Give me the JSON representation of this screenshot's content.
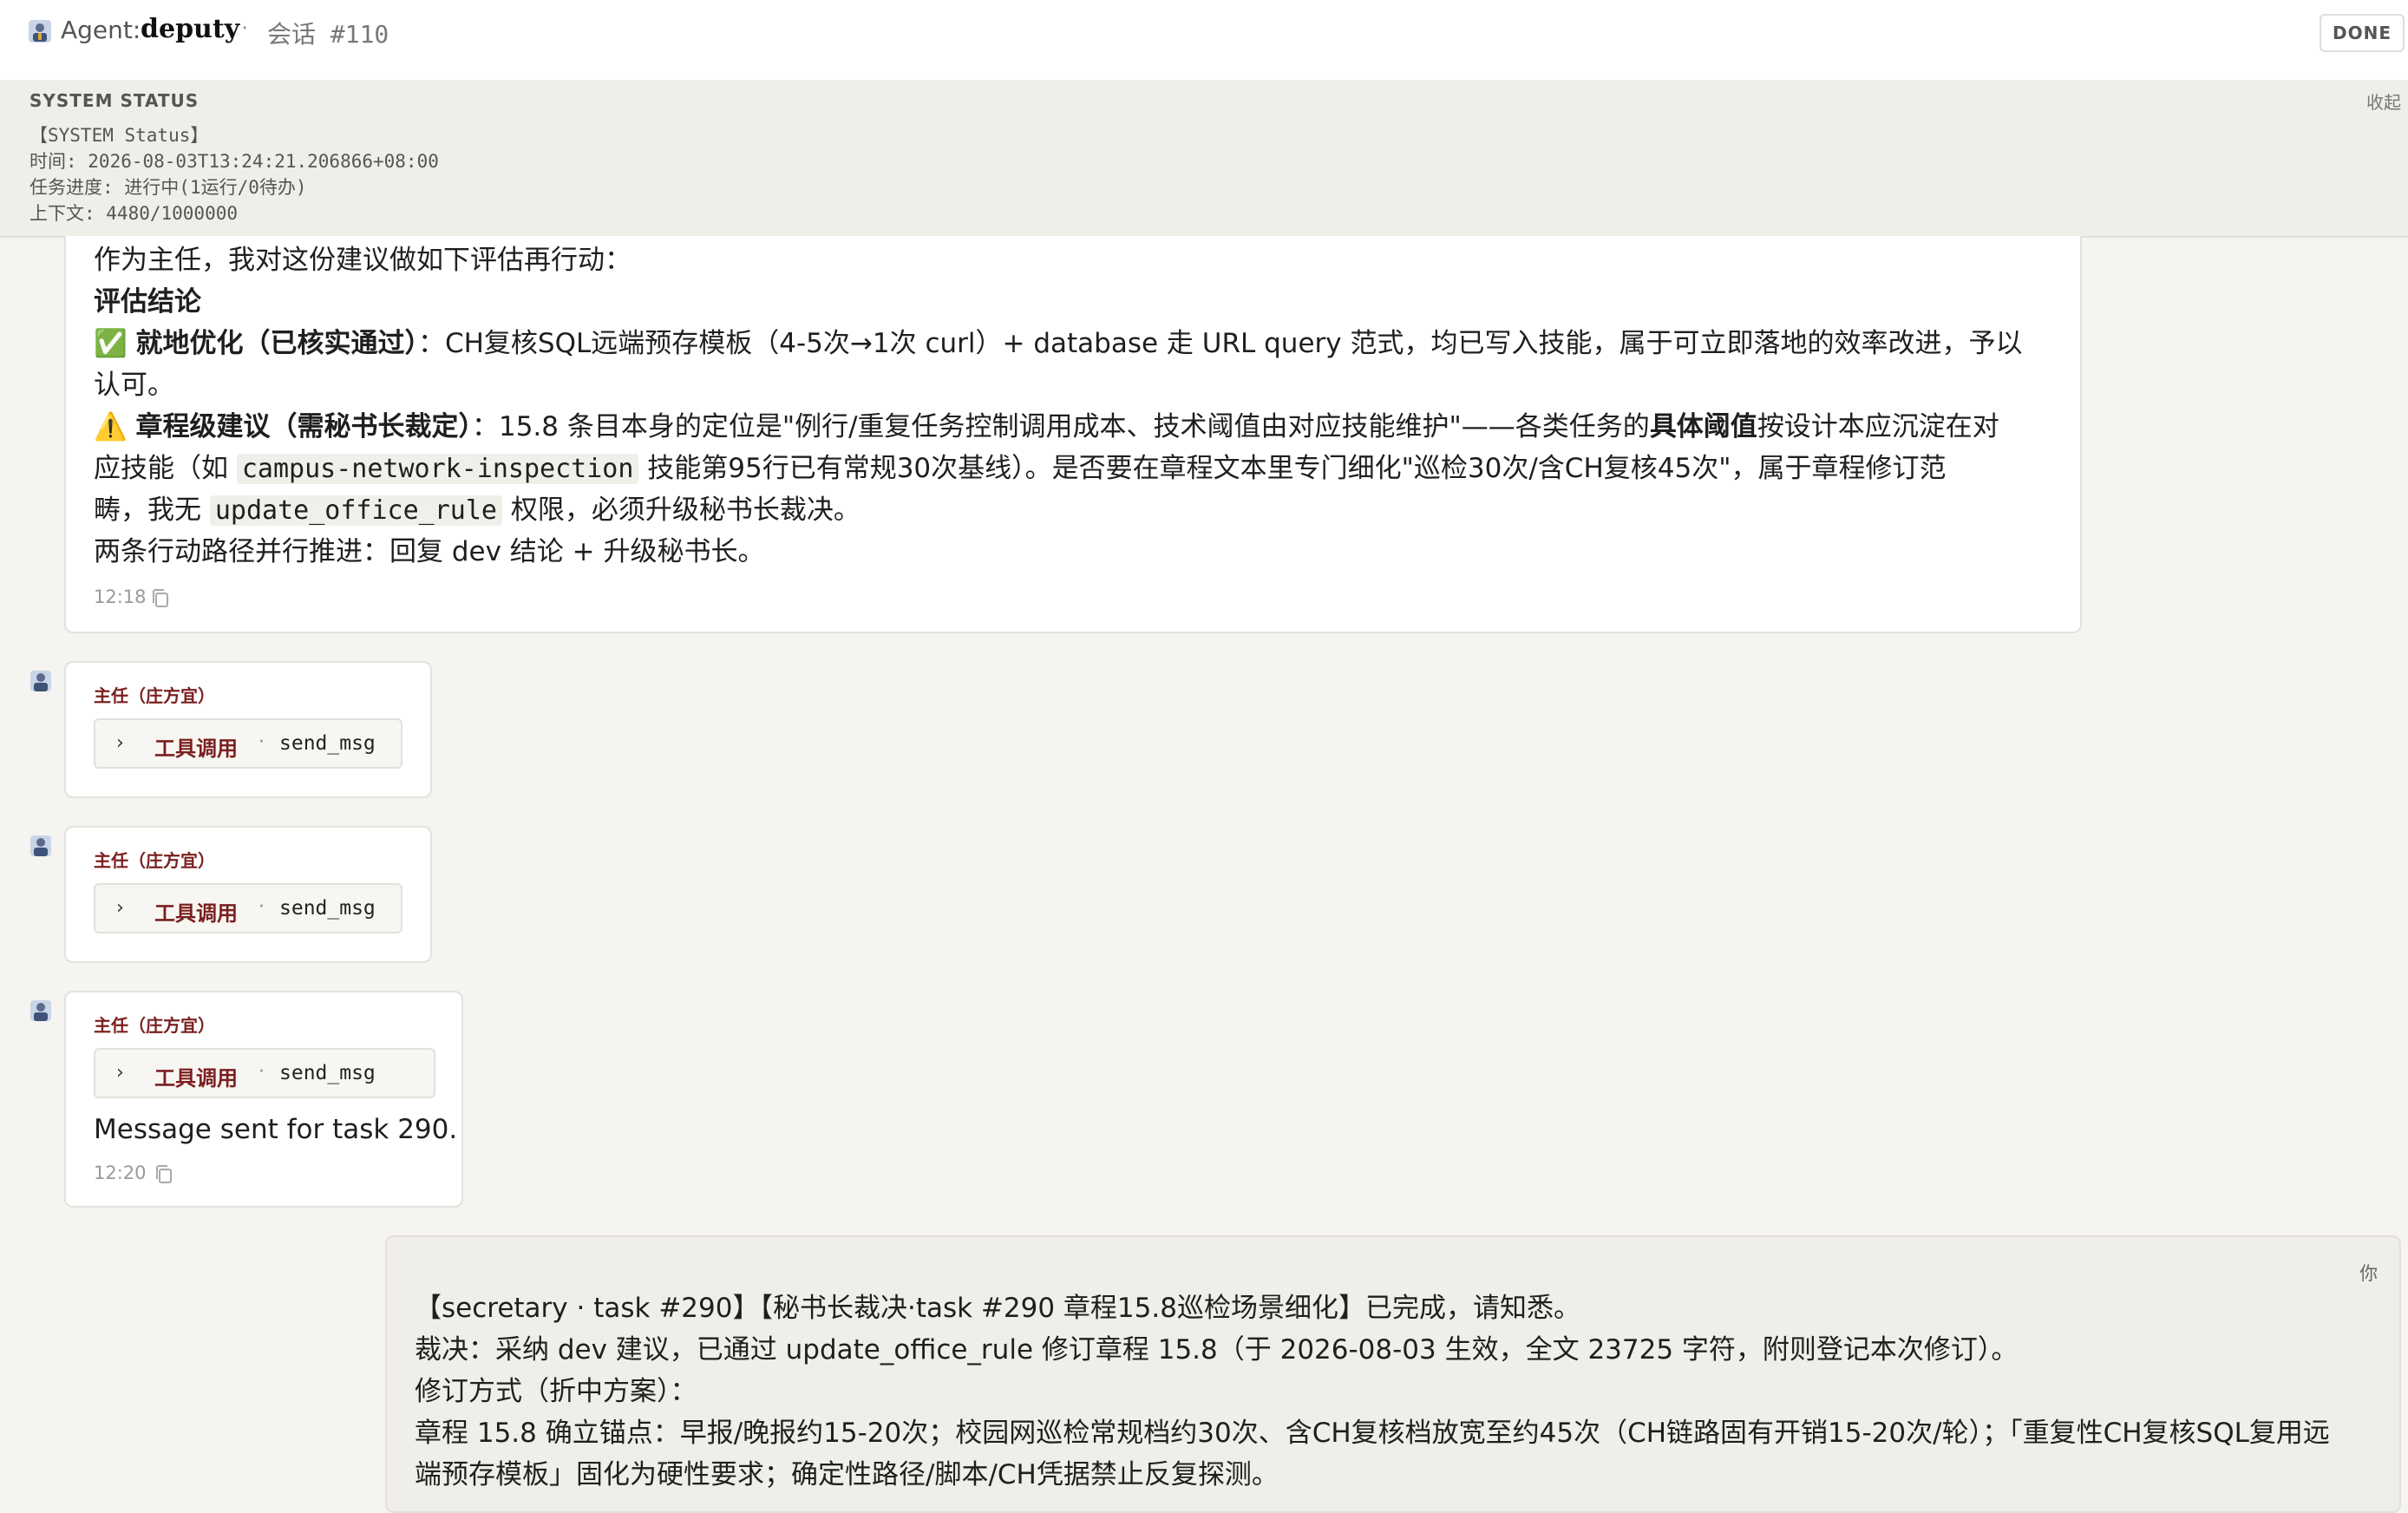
{
  "header": {
    "agent_label": "Agent:",
    "agent_name": "deputy",
    "separator": "·",
    "session": "会话 #110",
    "done_button": "DONE"
  },
  "system_status": {
    "title": "SYSTEM STATUS",
    "collapse": "收起",
    "lines": [
      "【SYSTEM Status】",
      "时间: 2026-08-03T13:24:21.206866+08:00",
      "任务进度: 进行中(1运行/0待办)",
      "上下文: 4480/1000000"
    ]
  },
  "messages": {
    "first": {
      "intro": "作为主任，我对这份建议做如下评估再行动：",
      "heading": "评估结论",
      "item1_icon": "✅",
      "item1_bold": "就地优化（已核实通过）",
      "item1_text_a": "：CH复核SQL远端预存模板（4-5次→1次 curl）+ database 走 URL query 范式，均已写入技能，属于可立即落地的效率改进，予以",
      "item1_text_b": "认可。",
      "item2_icon": "⚠️",
      "item2_bold": "章程级建议（需秘书长裁定）",
      "item2_text_a1": "：15.8 条目本身的定位是\"例行/重复任务控制调用成本、技术阈值由对应技能维护\"——各类任务的",
      "item2_bold2": "具体阈值",
      "item2_text_a2": "按设计本应沉淀在对",
      "item2_text_b1": "应技能（如 ",
      "item2_code1": "campus-network-inspection",
      "item2_text_b2": " 技能第95行已有常规30次基线）。是否要在章程文本里专门细化\"巡检30次/含CH复核45次\"，属于章程修订范",
      "item2_text_c1": "畴，我无 ",
      "item2_code2": "update_office_rule",
      "item2_text_c2": " 权限，必须升级秘书长裁决。",
      "closing": "两条行动路径并行推进：回复 dev 结论 + 升级秘书长。",
      "time": "12:18"
    },
    "tool1": {
      "sender": "主任（庄方宜）",
      "tool_label": "工具调用",
      "sep": "·",
      "tool_name": "send_msg"
    },
    "tool2": {
      "sender": "主任（庄方宜）",
      "tool_label": "工具调用",
      "sep": "·",
      "tool_name": "send_msg"
    },
    "tool3": {
      "sender": "主任（庄方宜）",
      "tool_label": "工具调用",
      "sep": "·",
      "tool_name": "send_msg",
      "result": "Message sent for task 290.",
      "time": "12:20"
    },
    "user": {
      "label": "你",
      "line1": "【secretary · task #290】【秘书长裁决·task #290 章程15.8巡检场景细化】已完成，请知悉。",
      "line2": "裁决：采纳 dev 建议，已通过 update_office_rule 修订章程 15.8（于 2026-08-03 生效，全文 23725 字符，附则登记本次修订）。",
      "line3": "修订方式（折中方案）：",
      "line4": "章程 15.8 确立锚点：早报/晚报约15-20次；校园网巡检常规档约30次、含CH复核档放宽至约45次（CH链路固有开销15-20次/轮）；「重复性CH复核SQL复用远",
      "line5": "端预存模板」固化为硬性要求；确定性路径/脚本/CH凭据禁止反复探测。"
    }
  }
}
